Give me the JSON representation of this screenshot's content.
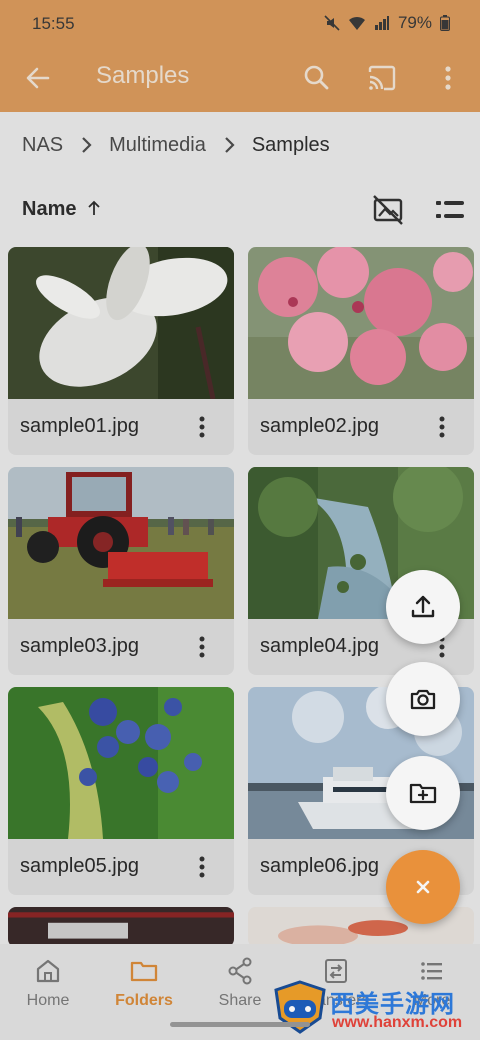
{
  "status": {
    "time": "15:55",
    "battery": "79%"
  },
  "appbar": {
    "title": "Samples"
  },
  "breadcrumb": [
    {
      "label": "NAS"
    },
    {
      "label": "Multimedia"
    },
    {
      "label": "Samples"
    }
  ],
  "sort": {
    "label": "Name"
  },
  "files": [
    {
      "name": "sample01.jpg"
    },
    {
      "name": "sample02.jpg"
    },
    {
      "name": "sample03.jpg"
    },
    {
      "name": "sample04.jpg"
    },
    {
      "name": "sample05.jpg"
    },
    {
      "name": "sample06.jpg"
    }
  ],
  "nav": [
    {
      "label": "Home",
      "icon": "home-icon"
    },
    {
      "label": "Folders",
      "icon": "folder-icon",
      "active": true
    },
    {
      "label": "Share",
      "icon": "share-icon"
    },
    {
      "label": "Transfers",
      "icon": "transfer-icon"
    },
    {
      "label": "More",
      "icon": "menu-icon"
    }
  ],
  "watermark": {
    "title": "西美手游网",
    "url": "www.hanxm.com"
  },
  "colors": {
    "accent": "#f3973e",
    "appbar": "#d99a5c",
    "active_nav": "#d98b3a"
  }
}
